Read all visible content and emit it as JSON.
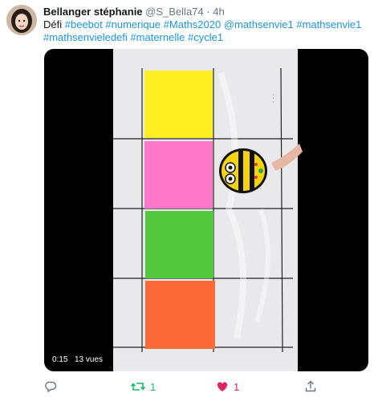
{
  "tweet": {
    "author_name": "Bellanger stéphanie",
    "author_handle": "@S_Bella74",
    "separator": "·",
    "timestamp": "4h",
    "text_prefix": "Défi",
    "hashtags_line1": [
      "#beebot",
      "#numerique",
      "#Maths2020"
    ],
    "mention": "@mathsenvie1",
    "hashtag_mathsenvie1": "#mathsenvie1",
    "hashtags_line2": [
      "#mathsenvieledefi",
      "#maternelle",
      "#cycle1"
    ]
  },
  "video": {
    "duration": "0:15",
    "views": "13 vues",
    "mat_squares": [
      "yellow",
      "pink",
      "green",
      "orange"
    ],
    "colors": {
      "yellow": "#ffee22",
      "pink": "#ff77c9",
      "green": "#54c83d",
      "orange": "#f96a37"
    }
  },
  "actions": {
    "retweet_count": "1",
    "like_count": "1"
  },
  "colors": {
    "link": "#1b95e0",
    "retweet": "#17bf63",
    "like": "#e0245e",
    "muted": "#657786"
  }
}
